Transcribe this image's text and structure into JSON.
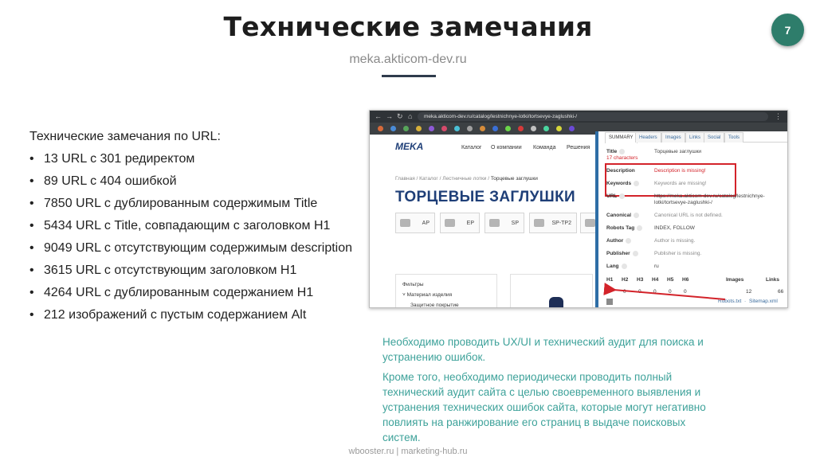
{
  "slide": {
    "title": "Технические замечания",
    "page_number": "7",
    "subtitle": "meka.akticom-dev.ru"
  },
  "findings": {
    "intro": "Технические замечания по URL:",
    "items": [
      "13 URL с 301 редиректом",
      "89 URL с 404 ошибкой",
      "7850 URL с дублированным содержимым Title",
      "5434 URL с Title, совпадающим с заголовком H1",
      "9049 URL с отсутствующим содержимым description",
      "3615 URL с отсутствующим заголовком H1",
      "4264 URL с дублированным содержанием H1",
      "212 изображений с пустым содержанием Alt"
    ]
  },
  "screenshot": {
    "browser": {
      "url": "meka.akticom-dev.ru/catalog/lestnichnye-lotki/tortsevye-zaglushki-/"
    },
    "site": {
      "logo": "MEKA",
      "nav": [
        "Каталог",
        "О компании",
        "Команда",
        "Решения"
      ],
      "breadcrumb_prefix": "Главная / Каталог / Лестничные лотки / ",
      "breadcrumb_current": "Торцевые заглушки",
      "product_title": "ТОРЦЕВЫЕ ЗАГЛУШКИ",
      "variants": [
        "АР",
        "ЕР",
        "SP",
        "SP-TP2"
      ],
      "filters_title": "Фильтры",
      "filters_item": "Материал изделия",
      "filters_sub": "Защитное покрытие"
    },
    "seo_panel": {
      "tabs": [
        "SUMMARY",
        "Headers",
        "Images",
        "Links",
        "Social",
        "Tools"
      ],
      "rows": {
        "title_key": "Title",
        "title_val": "Торцевые заглушки",
        "title_note": "17 characters",
        "description_key": "Description",
        "description_val": "Description is missing!",
        "keywords_key": "Keywords",
        "keywords_val": "Keywords are missing!",
        "url_key": "URL",
        "url_val_1": "https://meka.akticom-dev.ru/catalog/lestnichnye-",
        "url_val_2": "lotki/tortsevye-zaglushki-/",
        "canonical_key": "Canonical",
        "canonical_val": "Canonical URL is not defined.",
        "robots_key": "Robots Tag",
        "robots_val": "INDEX, FOLLOW",
        "author_key": "Author",
        "author_val": "Author is missing.",
        "publisher_key": "Publisher",
        "publisher_val": "Publisher is missing.",
        "lang_key": "Lang",
        "lang_val": "ru"
      },
      "headings": [
        "H1",
        "H2",
        "H3",
        "H4",
        "H5",
        "H6"
      ],
      "counts": [
        "0",
        "0",
        "0",
        "0",
        "0",
        "0"
      ],
      "images_label": "Images",
      "images_count": "12",
      "links_label": "Links",
      "links_count": "66",
      "robots_link": "Robots.txt",
      "sitemap_link": "Sitemap.xml"
    }
  },
  "notes": {
    "p1": "Необходимо проводить UX/UI и технический аудит для поиска и устранению ошибок.",
    "p2": "Кроме того, необходимо периодически проводить полный технический аудит сайта с целью своевременного выявления и устранения технических ошибок сайта, которые могут негативно повлиять на ранжирование его страниц в выдаче поисковых систем."
  },
  "footer": "wbooster.ru   |   marketing-hub.ru",
  "colors": {
    "accent_green": "#2e7d6b",
    "note_teal": "#3ea29a",
    "error_red": "#d3232a",
    "brand_blue": "#1f3f78"
  }
}
